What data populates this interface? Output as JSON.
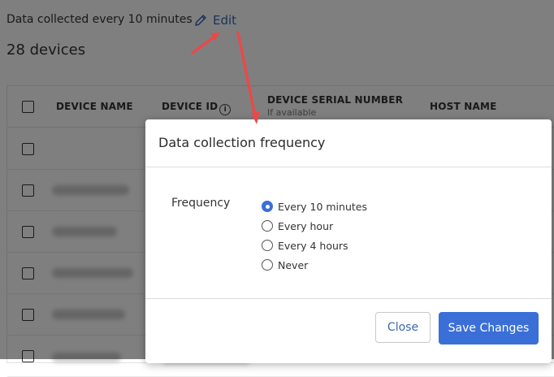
{
  "header": {
    "collection_text": "Data collected every 10 minutes",
    "edit_label": "Edit",
    "device_count": "28 devices"
  },
  "table": {
    "columns": [
      {
        "label": "DEVICE NAME",
        "sub": ""
      },
      {
        "label": "DEVICE ID",
        "sub": ""
      },
      {
        "label": "DEVICE SERIAL NUMBER",
        "sub": "If available"
      },
      {
        "label": "HOST NAME",
        "sub": ""
      }
    ],
    "info_glyph": "i"
  },
  "modal": {
    "title": "Data collection frequency",
    "frequency_label": "Frequency",
    "options": [
      {
        "label": "Every 10 minutes",
        "checked": true
      },
      {
        "label": "Every hour",
        "checked": false
      },
      {
        "label": "Every 4 hours",
        "checked": false
      },
      {
        "label": "Never",
        "checked": false
      }
    ],
    "close_label": "Close",
    "save_label": "Save Changes"
  },
  "colors": {
    "accent": "#3a6fd8",
    "link": "#3b67b3",
    "annotation_arrow": "#e84a4a",
    "overlay": "rgba(0,0,0,0.5)"
  },
  "icons": {
    "edit": "pencil-icon",
    "info": "info-icon",
    "annotation": "arrow-icon"
  }
}
